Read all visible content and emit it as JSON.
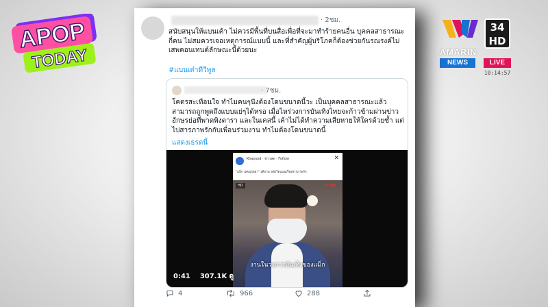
{
  "logos": {
    "apop_line1": "APOP",
    "apop_line2": "TODAY",
    "channel_brand": "AMARIN",
    "channel_number": "34",
    "channel_hd": "HD",
    "news_badge": "NEWS",
    "live_badge": "LIVE",
    "broadcast_time": "10:14:57",
    "colors": {
      "apop_pink": "#ff4fa3",
      "apop_green": "#9ef01a",
      "news_blue": "#1873d3",
      "live_pink": "#e0145a"
    }
  },
  "tweet": {
    "time": "· 2ชม.",
    "text": "สนับสนุนให้แบนเค้า ไม่ควรมีพื้นที่บนสื่อเพื่อที่จะมาทำร้ายคนอื่น บุคคลสาธารณะกี่คน ไม่สมควรเจอเหตุการณ์แบบนี้ และที่สำคัญผู้บริโภคก็ต้องช่วยกันรณรงค์ไม่เสพคอนเทนต์ลักษณะนี้ด้วยนะ",
    "hashtag": "#แบนเต๋าทีวีพูล",
    "quote": {
      "time": "· 7ชม.",
      "text": "โคตรสะเทือนใจ ทำไมคนๆนึงต้องโดนขนาดนี้วะ เป็นบุคคลสาธารณะแล้วสามารถถูกพูดถึงแบบแย่ๆได้หรอ เมื่อไหร่วงการบันเทิงไทยจะก้าวข้ามผ่านข่าวอักษรย่อที่พาดพิงดารา และในเคสนี้ เค้าไม่ได้ทำความเสียหายให้ใครด้วยซ้ำ แต่ไปสารภาพรักกับเพื่อนร่วมงาน ทำไมต้องโดนขนาดนี้",
      "show_thread": "แสดงเธรดนี้",
      "video": {
        "source_name": "Khaosod · ข่าวสด · Follow",
        "caption": "\"แม็ก เลขบุรุษยา\" ยุติงาน หลังโดนแฉเรื่องสารภาพรัก",
        "subtitle": "งานในวงการบันเทิงของแม็ก",
        "tag": "HD",
        "red_tag": "ข่าวสด",
        "duration": "0:41",
        "views": "307.1K ดู"
      }
    },
    "actions": {
      "replies": "4",
      "retweets": "966",
      "likes": "288"
    }
  }
}
